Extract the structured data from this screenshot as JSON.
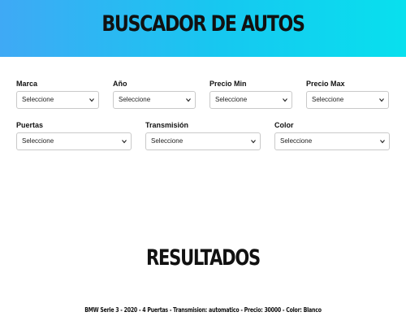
{
  "header": {
    "title": "BUSCADOR DE AUTOS"
  },
  "filters": {
    "marca": {
      "label": "Marca",
      "value": "Seleccione"
    },
    "anio": {
      "label": "Año",
      "value": "Seleccione"
    },
    "precio_min": {
      "label": "Precio Min",
      "value": "Seleccione"
    },
    "precio_max": {
      "label": "Precio Max",
      "value": "Seleccione"
    },
    "puertas": {
      "label": "Puertas",
      "value": "Seleccione"
    },
    "transmision": {
      "label": "Transmisión",
      "value": "Seleccione"
    },
    "color": {
      "label": "Color",
      "value": "Seleccione"
    }
  },
  "results": {
    "title": "RESULTADOS",
    "items": [
      "BMW Serie 3 - 2020 - 4 Puertas - Transmision: automatico - Precio: 30000 - Color: Blanco"
    ]
  },
  "icons": {
    "select_arrow": "chevron-down-icon"
  },
  "colors": {
    "header_gradient_start": "#3fa9f5",
    "header_gradient_end": "#08e0ee"
  }
}
